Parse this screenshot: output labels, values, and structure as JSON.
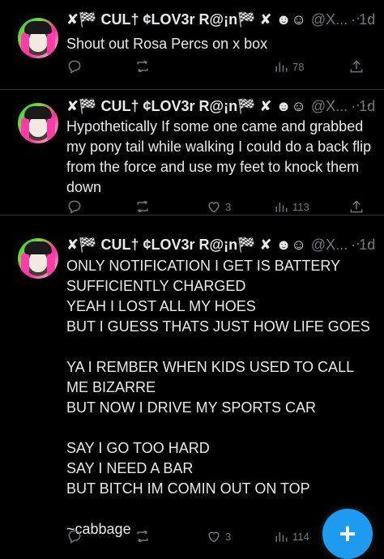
{
  "tweets": [
    {
      "name": "✘🏁 CUL† ¢LOV3r R@¡n🏁 ✘ ☻☺",
      "handle": "@X...",
      "dot": "·",
      "time": "1d",
      "more": "···",
      "text": "Shout out Rosa Percs on x box",
      "replies": "",
      "retweets": "",
      "likes": "",
      "views": "78"
    },
    {
      "name": "✘🏁 CUL† ¢LOV3r R@¡n🏁 ✘ ☻☺",
      "handle": "@X...",
      "dot": "·",
      "time": "1d",
      "more": "···",
      "text": "Hypothetically If some one came and grabbed my pony tail while walking I could do a back flip from the force and use my feet to knock them down",
      "replies": "",
      "retweets": "",
      "likes": "3",
      "views": "113"
    },
    {
      "name": "✘🏁 CUL† ¢LOV3r R@¡n🏁 ✘ ☻☺",
      "handle": "@X...",
      "dot": "·",
      "time": "1d",
      "more": "···",
      "text": "ONLY NOTIFICATION I GET IS BATTERY SUFFICIENTLY CHARGED\nYEAH I LOST ALL MY HOES\nBUT I GUESS THATS  JUST HOW LIFE GOES\n\nYA I REMBER WHEN KIDS USED TO CALL ME BIZARRE\nBUT NOW I DRIVE MY SPORTS CAR\n\nSAY I GO TOO HARD\nSAY I NEED A BAR\nBUT BITCH IM COMIN OUT ON TOP\n\n~cabbage",
      "replies": "",
      "retweets": "",
      "likes": "3",
      "views": "114"
    }
  ],
  "fab": {
    "label": "+"
  },
  "icons": {
    "reply": "reply-icon",
    "retweet": "retweet-icon",
    "like": "heart-icon",
    "views": "views-icon",
    "share": "share-icon"
  },
  "colors": {
    "background": "#000000",
    "text": "#e7e9ea",
    "muted": "#71767b",
    "accent": "#1d9bf0"
  }
}
